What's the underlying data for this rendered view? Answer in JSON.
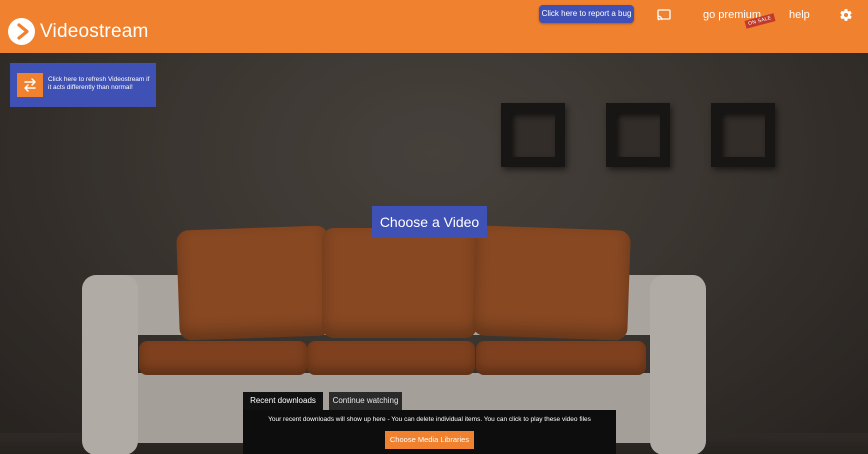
{
  "header": {
    "app_name": "Videostream",
    "report_bug": "Click here to report a bug",
    "premium": "go premium",
    "on_sale": "ON SALE",
    "help": "help",
    "icons": [
      "play-logo-icon",
      "cast-icon",
      "gear-icon"
    ]
  },
  "refresh": {
    "text": "Click here to refresh Videostream if it acts differently than normal!",
    "icon": "refresh-arrows-icon"
  },
  "main": {
    "choose_video": "Choose a Video"
  },
  "bottom": {
    "tabs": [
      {
        "label": "Recent downloads"
      },
      {
        "label": "Continue watching"
      }
    ],
    "message": "Your recent downloads will show up here - You can delete individual items. You can click to play these video files",
    "libraries_button": "Choose Media Libraries"
  },
  "colors": {
    "header": "#f0812f",
    "accent_blue": "#3f51b5",
    "panel": "#0d0d0d"
  }
}
